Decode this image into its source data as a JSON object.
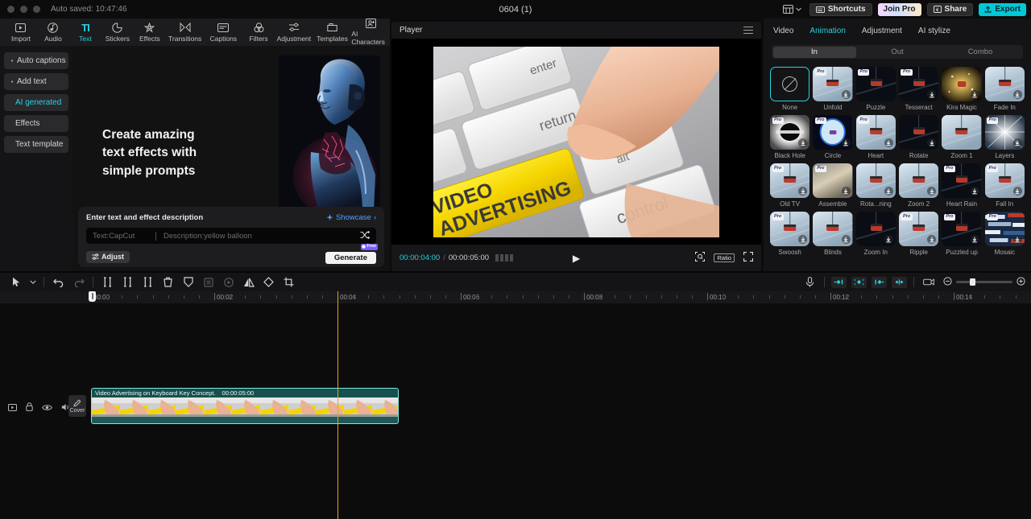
{
  "titlebar": {
    "autosave": "Auto saved: 10:47:46",
    "window_title": "0604 (1)",
    "shortcuts_label": "Shortcuts",
    "join_pro_label": "Join Pro",
    "share_label": "Share",
    "export_label": "Export",
    "accent_export": "#00c8d7"
  },
  "tooltabs": [
    {
      "label": "Import",
      "icon": "import-icon",
      "active": false
    },
    {
      "label": "Audio",
      "icon": "audio-icon",
      "active": false
    },
    {
      "label": "Text",
      "icon": "text-icon",
      "active": true
    },
    {
      "label": "Stickers",
      "icon": "sticker-icon",
      "active": false
    },
    {
      "label": "Effects",
      "icon": "effects-icon",
      "active": false
    },
    {
      "label": "Transitions",
      "icon": "transitions-icon",
      "active": false
    },
    {
      "label": "Captions",
      "icon": "captions-icon",
      "active": false
    },
    {
      "label": "Filters",
      "icon": "filters-icon",
      "active": false
    },
    {
      "label": "Adjustment",
      "icon": "adjustment-icon",
      "active": false
    },
    {
      "label": "Templates",
      "icon": "templates-icon",
      "active": false
    },
    {
      "label": "AI Characters",
      "icon": "ai-characters-icon",
      "active": false
    }
  ],
  "left_nav": [
    {
      "label": "Auto captions",
      "caret": "▸",
      "active": false
    },
    {
      "label": "Add text",
      "caret": "▸",
      "active": false
    },
    {
      "label": "AI generated",
      "caret": "",
      "active": true
    },
    {
      "label": "Effects",
      "caret": "",
      "active": false
    },
    {
      "label": "Text template",
      "caret": "",
      "active": false
    }
  ],
  "hero": {
    "headline_line1": "Create amazing",
    "headline_line2": "text effects with",
    "headline_line3": "simple prompts"
  },
  "prompt": {
    "title": "Enter text and effect description",
    "showcase_label": "Showcase",
    "showcase_chevron": "›",
    "text_placeholder": "Text:CapCut",
    "desc_placeholder": "Description:yellow balloon",
    "shuffle_icon": "shuffle-icon",
    "adjust_label": "Adjust",
    "generate_label": "Generate",
    "free_badge": "Free"
  },
  "player": {
    "title": "Player",
    "current_time": "00:00:04:00",
    "separator": "/",
    "total_time": "00:00:05:00",
    "play_icon": "▶",
    "ratio_label": "Ratio",
    "video_text_line1": "VIDEO",
    "video_text_line2": "ADVERTISING",
    "key_enter": "enter",
    "key_return": "return",
    "key_alt": "alt",
    "key_control": "control"
  },
  "right_panel": {
    "tabs": [
      {
        "label": "Video",
        "active": false
      },
      {
        "label": "Animation",
        "active": true
      },
      {
        "label": "Adjustment",
        "active": false
      },
      {
        "label": "AI stylize",
        "active": false
      }
    ],
    "segments": [
      {
        "label": "In",
        "active": true
      },
      {
        "label": "Out",
        "active": false
      },
      {
        "label": "Combo",
        "active": false
      }
    ],
    "animations": [
      {
        "label": "None",
        "pro": false,
        "download": false,
        "selected": true,
        "style": "none"
      },
      {
        "label": "Unfold",
        "pro": true,
        "download": true,
        "selected": false,
        "style": "snow"
      },
      {
        "label": "Puzzle",
        "pro": true,
        "download": false,
        "selected": false,
        "style": "dark"
      },
      {
        "label": "Tesseract",
        "pro": true,
        "download": true,
        "selected": false,
        "style": "dark"
      },
      {
        "label": "Kira Magic",
        "pro": false,
        "download": true,
        "selected": false,
        "style": "gold"
      },
      {
        "label": "Fade In",
        "pro": false,
        "download": true,
        "selected": false,
        "style": "snow"
      },
      {
        "label": "Black Hole",
        "pro": true,
        "download": true,
        "selected": false,
        "style": "mono"
      },
      {
        "label": "Circle",
        "pro": true,
        "download": true,
        "selected": false,
        "style": "blue"
      },
      {
        "label": "Heart",
        "pro": true,
        "download": true,
        "selected": false,
        "style": "snow"
      },
      {
        "label": "Rotate",
        "pro": false,
        "download": true,
        "selected": false,
        "style": "dark"
      },
      {
        "label": "Zoom 1",
        "pro": false,
        "download": false,
        "selected": false,
        "style": "snow"
      },
      {
        "label": "Layers",
        "pro": true,
        "download": true,
        "selected": false,
        "style": "flare"
      },
      {
        "label": "Old TV",
        "pro": true,
        "download": true,
        "selected": false,
        "style": "snow"
      },
      {
        "label": "Assemble",
        "pro": true,
        "download": true,
        "selected": false,
        "style": "sepia"
      },
      {
        "label": "Rota...ning",
        "pro": false,
        "download": true,
        "selected": false,
        "style": "snow"
      },
      {
        "label": "Zoom 2",
        "pro": false,
        "download": true,
        "selected": false,
        "style": "snow"
      },
      {
        "label": "Heart Rain",
        "pro": true,
        "download": true,
        "selected": false,
        "style": "dark"
      },
      {
        "label": "Fall In",
        "pro": true,
        "download": true,
        "selected": false,
        "style": "snow"
      },
      {
        "label": "Swoosh",
        "pro": true,
        "download": true,
        "selected": false,
        "style": "snow"
      },
      {
        "label": "Blinds",
        "pro": false,
        "download": true,
        "selected": false,
        "style": "snow"
      },
      {
        "label": "Zoom In",
        "pro": false,
        "download": true,
        "selected": false,
        "style": "dark"
      },
      {
        "label": "Ripple",
        "pro": true,
        "download": true,
        "selected": false,
        "style": "snow"
      },
      {
        "label": "Puzzled up",
        "pro": true,
        "download": true,
        "selected": false,
        "style": "dark"
      },
      {
        "label": "Mosaic",
        "pro": true,
        "download": true,
        "selected": false,
        "style": "mosaic"
      }
    ]
  },
  "timeline": {
    "tools": [
      {
        "name": "select-tool",
        "glyph": "➤",
        "dim": false
      },
      {
        "name": "select-dropdown",
        "glyph": "∨",
        "dim": false
      },
      {
        "name": "undo-button",
        "glyph": "↶",
        "dim": false
      },
      {
        "name": "redo-button",
        "glyph": "↷",
        "dim": true
      },
      {
        "name": "split-button",
        "glyph": "][",
        "dim": false
      },
      {
        "name": "trim-left-button",
        "glyph": "][",
        "dim": false
      },
      {
        "name": "trim-right-button",
        "glyph": "][",
        "dim": false
      },
      {
        "name": "delete-button",
        "glyph": "⌧",
        "dim": false
      },
      {
        "name": "freeze-button",
        "glyph": "⭔",
        "dim": false
      },
      {
        "name": "crop-clip-button",
        "glyph": "▢",
        "dim": true
      },
      {
        "name": "reverse-button",
        "glyph": "○",
        "dim": true
      },
      {
        "name": "mirror-button",
        "glyph": "◧",
        "dim": false
      },
      {
        "name": "rotate-button",
        "glyph": "◇",
        "dim": false
      },
      {
        "name": "crop-button",
        "glyph": "⌧",
        "dim": false
      }
    ],
    "right_tools": [
      {
        "name": "record-voiceover-icon"
      },
      {
        "name": "keyframe-prev-icon"
      },
      {
        "name": "keyframe-add-icon"
      },
      {
        "name": "keyframe-next-icon"
      },
      {
        "name": "keyframe-split-icon"
      },
      {
        "name": "preview-mode-icon"
      }
    ],
    "ruler_labels": [
      "00:00",
      "00:02",
      "00:04",
      "00:06",
      "00:08",
      "00:10",
      "00:12",
      "00:14"
    ],
    "track_icons": [
      "track-preview-icon",
      "lock-icon",
      "eye-icon",
      "volume-icon"
    ],
    "cover_label": "Cover",
    "clip": {
      "name": "Video Advertising on Keyboard Key Concept.",
      "duration": "00:00:05:00"
    },
    "zoom_out_icon": "zoom-out-icon",
    "zoom_in_icon": "zoom-in-icon"
  }
}
